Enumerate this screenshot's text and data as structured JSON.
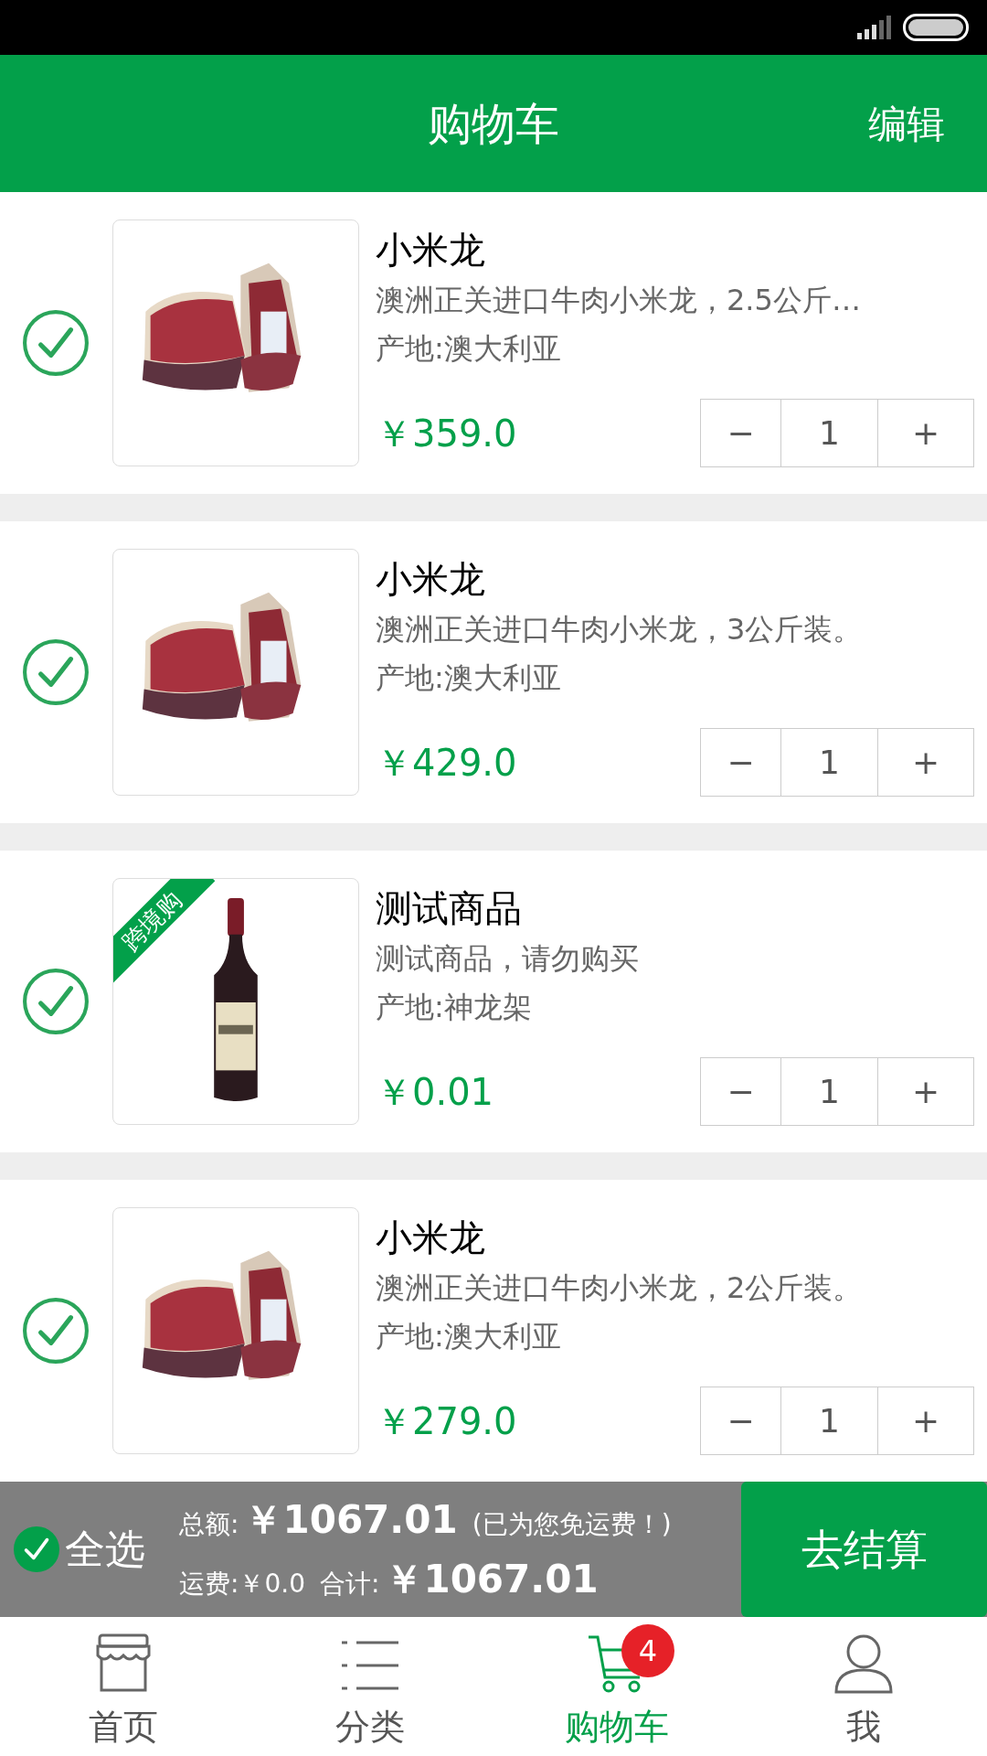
{
  "header": {
    "title": "购物车",
    "action": "编辑"
  },
  "items": [
    {
      "checked": true,
      "title": "小米龙",
      "description": "澳洲正关进口牛肉小米龙，2.5公斤…",
      "origin": "产地:澳大利亚",
      "price": "￥359.0",
      "quantity": "1",
      "minus": "−",
      "plus": "+"
    },
    {
      "checked": true,
      "title": "小米龙",
      "description": "澳洲正关进口牛肉小米龙，3公斤装。",
      "origin": "产地:澳大利亚",
      "price": "￥429.0",
      "quantity": "1",
      "minus": "−",
      "plus": "+"
    },
    {
      "checked": true,
      "title": "测试商品",
      "description": "测试商品，请勿购买",
      "origin": "产地:神龙架",
      "price": "￥0.01",
      "quantity": "1",
      "minus": "−",
      "plus": "+",
      "tag": "跨境购"
    },
    {
      "checked": true,
      "title": "小米龙",
      "description": "澳洲正关进口牛肉小米龙，2公斤装。",
      "origin": "产地:澳大利亚",
      "price": "￥279.0",
      "quantity": "1",
      "minus": "−",
      "plus": "+"
    }
  ],
  "summary": {
    "select_all": {
      "label": "全选",
      "checked": true
    },
    "total_label": "总额:",
    "total": "￥1067.01",
    "free_shipping_note": "(已为您免运费！)",
    "shipping": "运费:￥0.0",
    "sum_label": "合计:",
    "sum": "￥1067.01",
    "checkout": "去结算"
  },
  "tabs": [
    {
      "label": "首页",
      "selected": false
    },
    {
      "label": "分类",
      "selected": false
    },
    {
      "label": "购物车",
      "selected": true,
      "badge": "4"
    },
    {
      "label": "我",
      "selected": false
    }
  ]
}
